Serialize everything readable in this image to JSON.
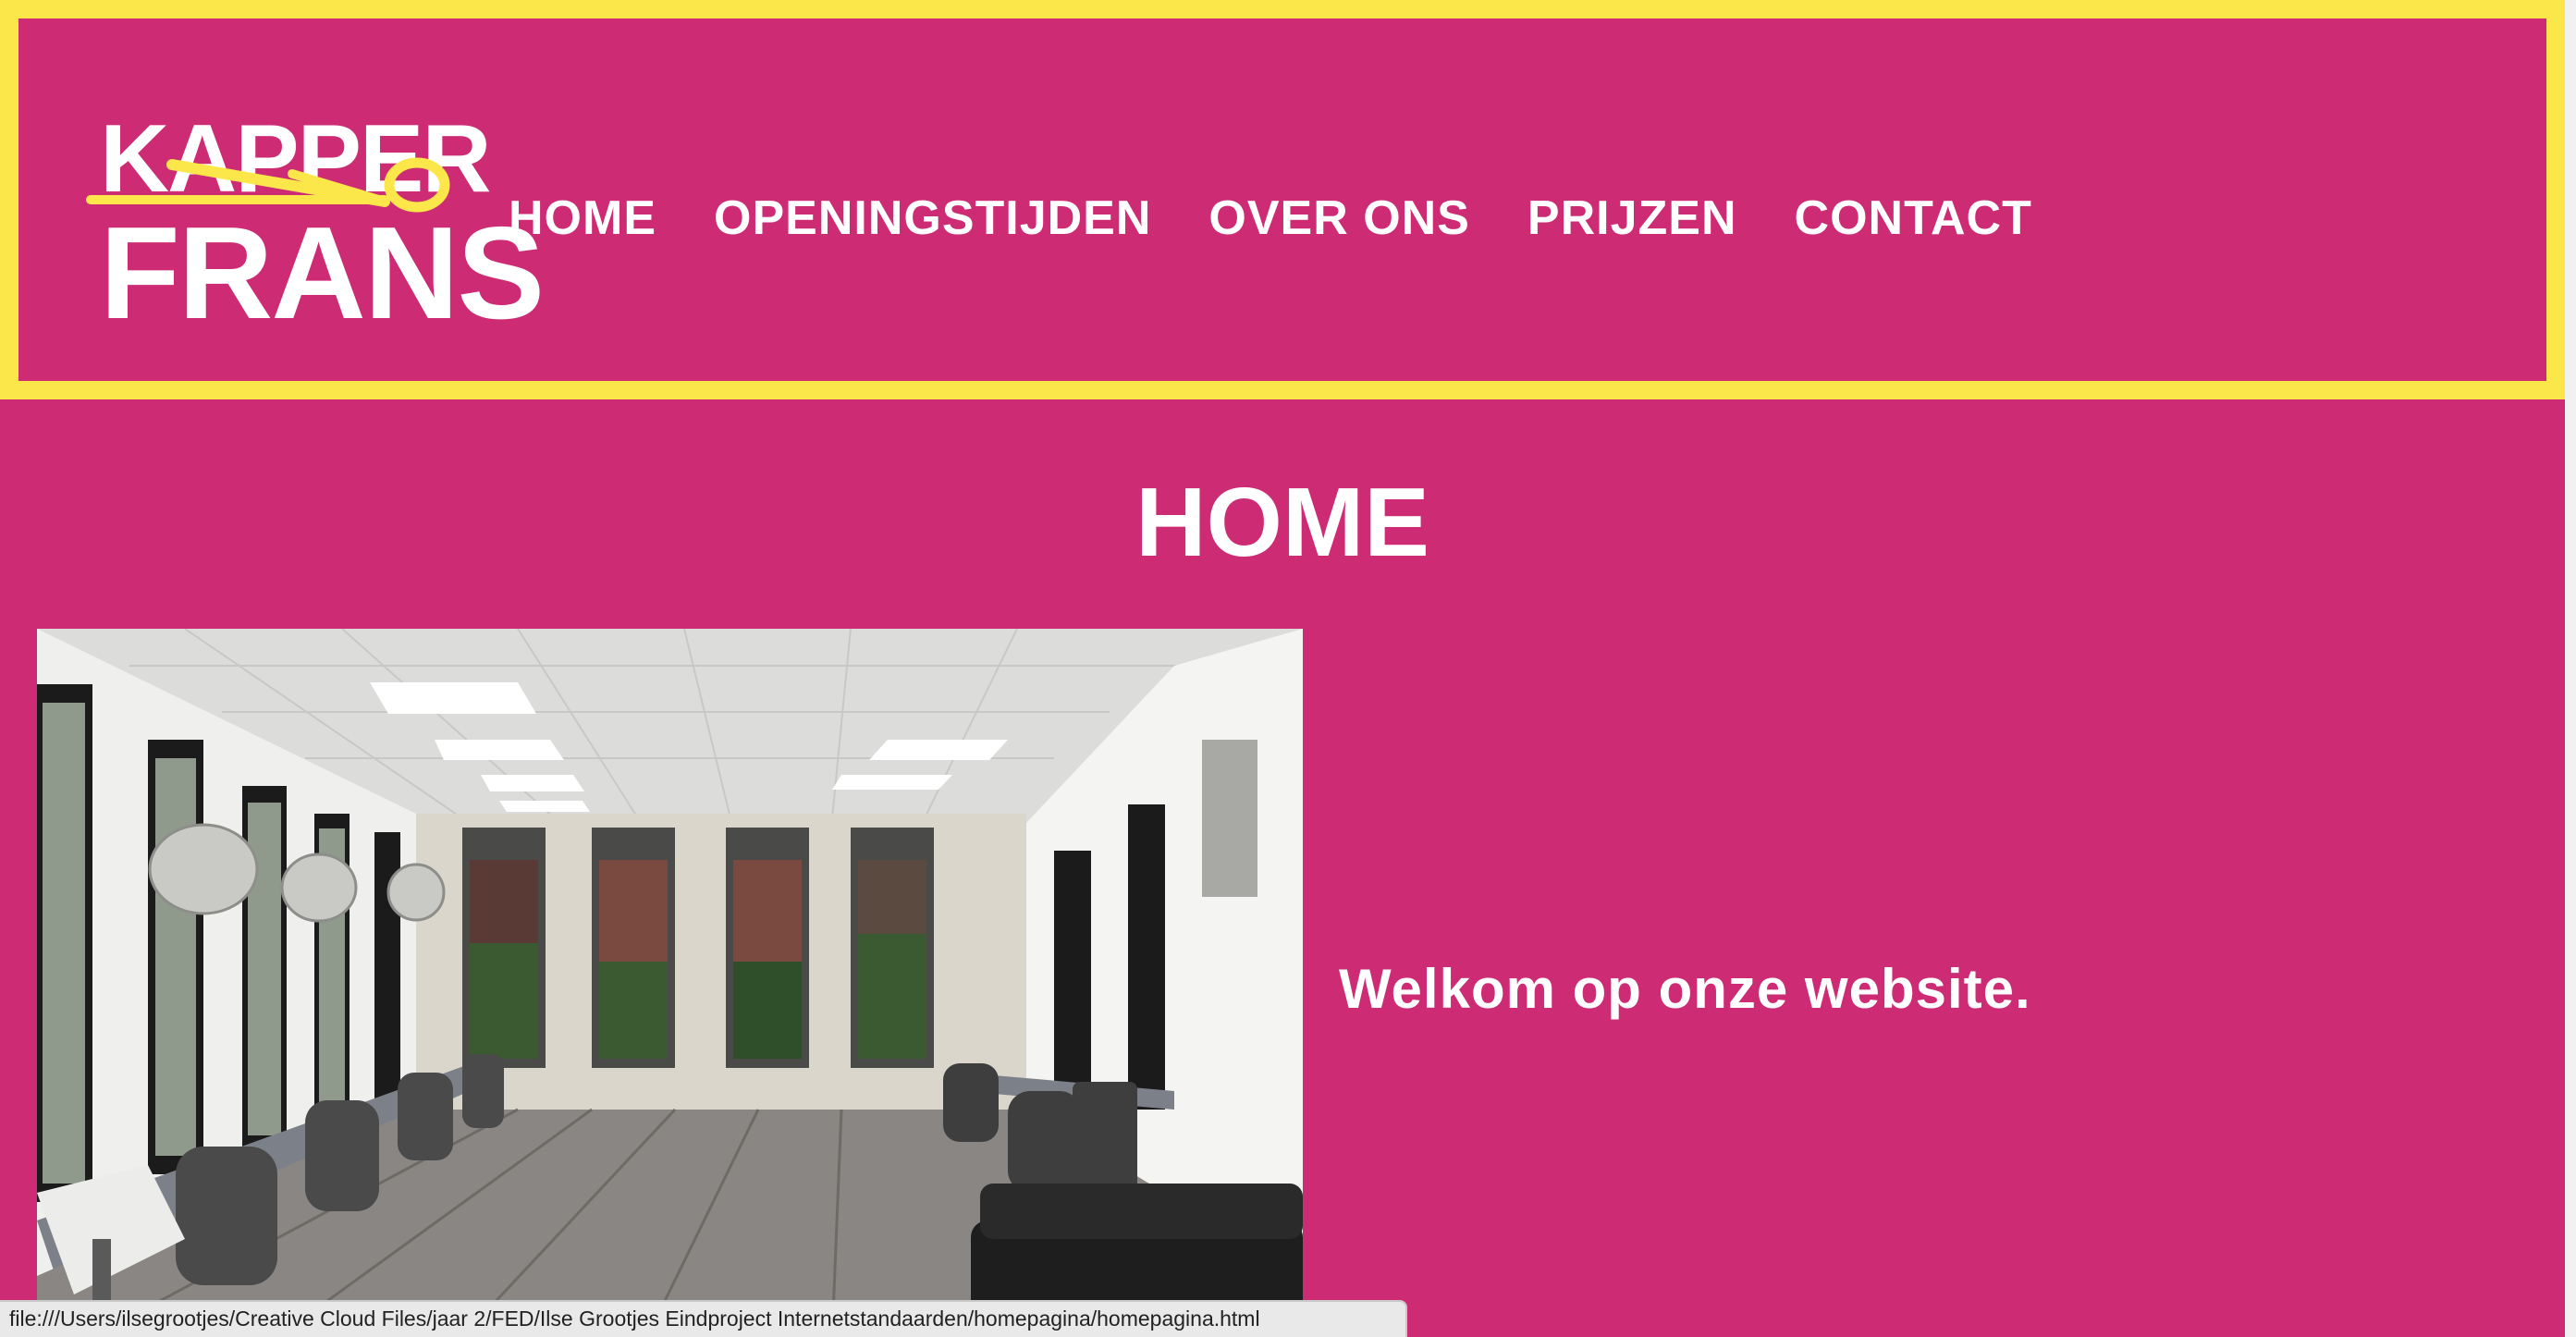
{
  "header": {
    "logo": {
      "line1": "KAPPER",
      "line2": "FRANS"
    },
    "nav": [
      {
        "label": "HOME"
      },
      {
        "label": "OPENINGSTIJDEN"
      },
      {
        "label": "OVER ONS"
      },
      {
        "label": "PRIJZEN"
      },
      {
        "label": "CONTACT"
      }
    ]
  },
  "main": {
    "title": "HOME",
    "welcome": "Welkom op onze website."
  },
  "status_bar": {
    "url": "file:///Users/ilsegrootjes/Creative Cloud Files/jaar 2/FED/Ilse Grootjes Eindproject Internetstandaarden/homepagina/homepagina.html"
  },
  "colors": {
    "background": "#cd2c74",
    "header_border": "#fbe74a",
    "text": "#ffffff",
    "scissors": "#fbe74a"
  },
  "icons": {
    "logo_scissors": "scissors-icon"
  }
}
